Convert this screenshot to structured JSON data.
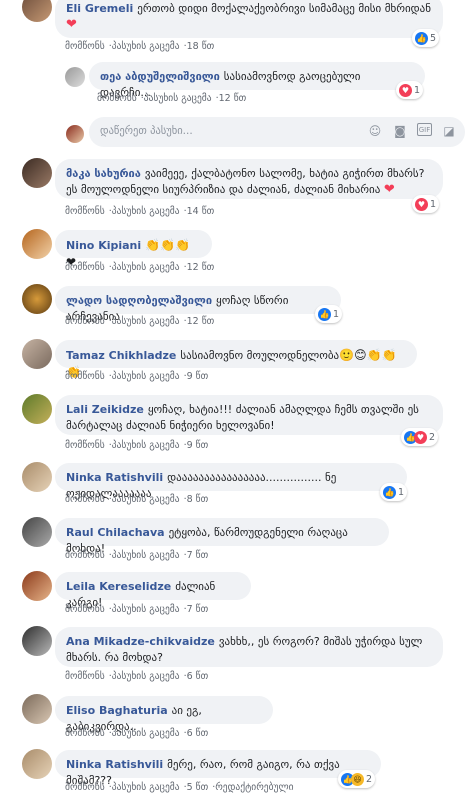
{
  "comments": [
    {
      "name": "Eli Gremeli",
      "text": "ერთობ დიდი მოქალაქეობრივი სიმამაცე მისი მხრიდან",
      "emoji": "❤",
      "time": "18 წთ",
      "reactions": {
        "count": "5",
        "icons": [
          "like"
        ]
      }
    },
    {
      "name": "თეა აბდუშელიშვილი",
      "text": "სასიამოვნოდ გაოცებული დავრჩი...",
      "time": "12 წთ",
      "reactions": {
        "count": "1",
        "icons": [
          "love"
        ]
      }
    },
    {
      "name": "მაკა სახურია",
      "text": "ვაიმეეე, ქალბატონო სალომე, ხატია გიჭირთ მხარს? ეს მოულოდნელი სიურპრიზია და ძალიან, ძალიან მიხარია",
      "emoji": "❤",
      "time": "14 წთ",
      "reactions": {
        "count": "1",
        "icons": [
          "love"
        ]
      }
    },
    {
      "name": "Nino Kipiani",
      "text": "",
      "emoji": "👏👏👏 ❤",
      "time": "12 წთ"
    },
    {
      "name": "ლადო სადღობელაშვილი",
      "text": "ყოჩაღ სწორი არჩევანია",
      "time": "12 წთ",
      "reactions": {
        "count": "1",
        "icons": [
          "like"
        ]
      }
    },
    {
      "name": "Tamaz Chikhladze",
      "text": "სასიამოვნო მოულოდნელობა",
      "emoji": "🙂😊👏👏👏",
      "time": "9 წთ"
    },
    {
      "name": "Lali Zeikidze",
      "text": "ყოჩაღ, ხატია!!! ძალიან ამაღლდა ჩემს თვალში ეს მარტალაც ძალიან ნიჭიერი ხელოვანი!",
      "time": "9 წთ",
      "reactions": {
        "count": "2",
        "icons": [
          "like",
          "love"
        ]
      }
    },
    {
      "name": "Ninka Ratishvili",
      "text": "დაააააააააააააააა................ ნე ოჟიდალააააააა",
      "time": "8 წთ",
      "reactions": {
        "count": "1",
        "icons": [
          "like"
        ]
      }
    },
    {
      "name": "Raul Chilachava",
      "text": "ეტყობა, წარმოუდგენელი რაღაცა მოხდა!",
      "time": "7 წთ"
    },
    {
      "name": "Leila Kereselidze",
      "text": "ძალიან კარგი!",
      "time": "7 წთ"
    },
    {
      "name": "Ana Mikadze-chikvaidze",
      "text": "ვახხხ,, ეს როგორ? მიშას უჭირდა სულ მხარს. რა მოხდა?",
      "time": "6 წთ"
    },
    {
      "name": "Eliso Baghaturia",
      "text": "აი ეგ, გაბიკვირდა..",
      "time": "6 წთ"
    },
    {
      "name": "Ninka Ratishvili",
      "text": "მერე, რაო, რომ გაიგო, რა თქვა მიშამ???",
      "time": "5 წთ",
      "edited": "რედაქტირებული",
      "reactions": {
        "count": "2",
        "icons": [
          "like",
          "haha"
        ]
      }
    }
  ],
  "labels": {
    "like": "მომწონს",
    "reply": "პასუხის გაცემა"
  },
  "reply_placeholder": "დაწერეთ პასუხი...",
  "icons": {
    "emoji": "smiley-icon",
    "camera": "camera-icon",
    "gif": "gif-icon",
    "sticker": "sticker-icon"
  },
  "colors": {
    "name": "#385898",
    "bubble": "#f0f2f5",
    "like": "#1877f2",
    "love": "#f33e58"
  }
}
